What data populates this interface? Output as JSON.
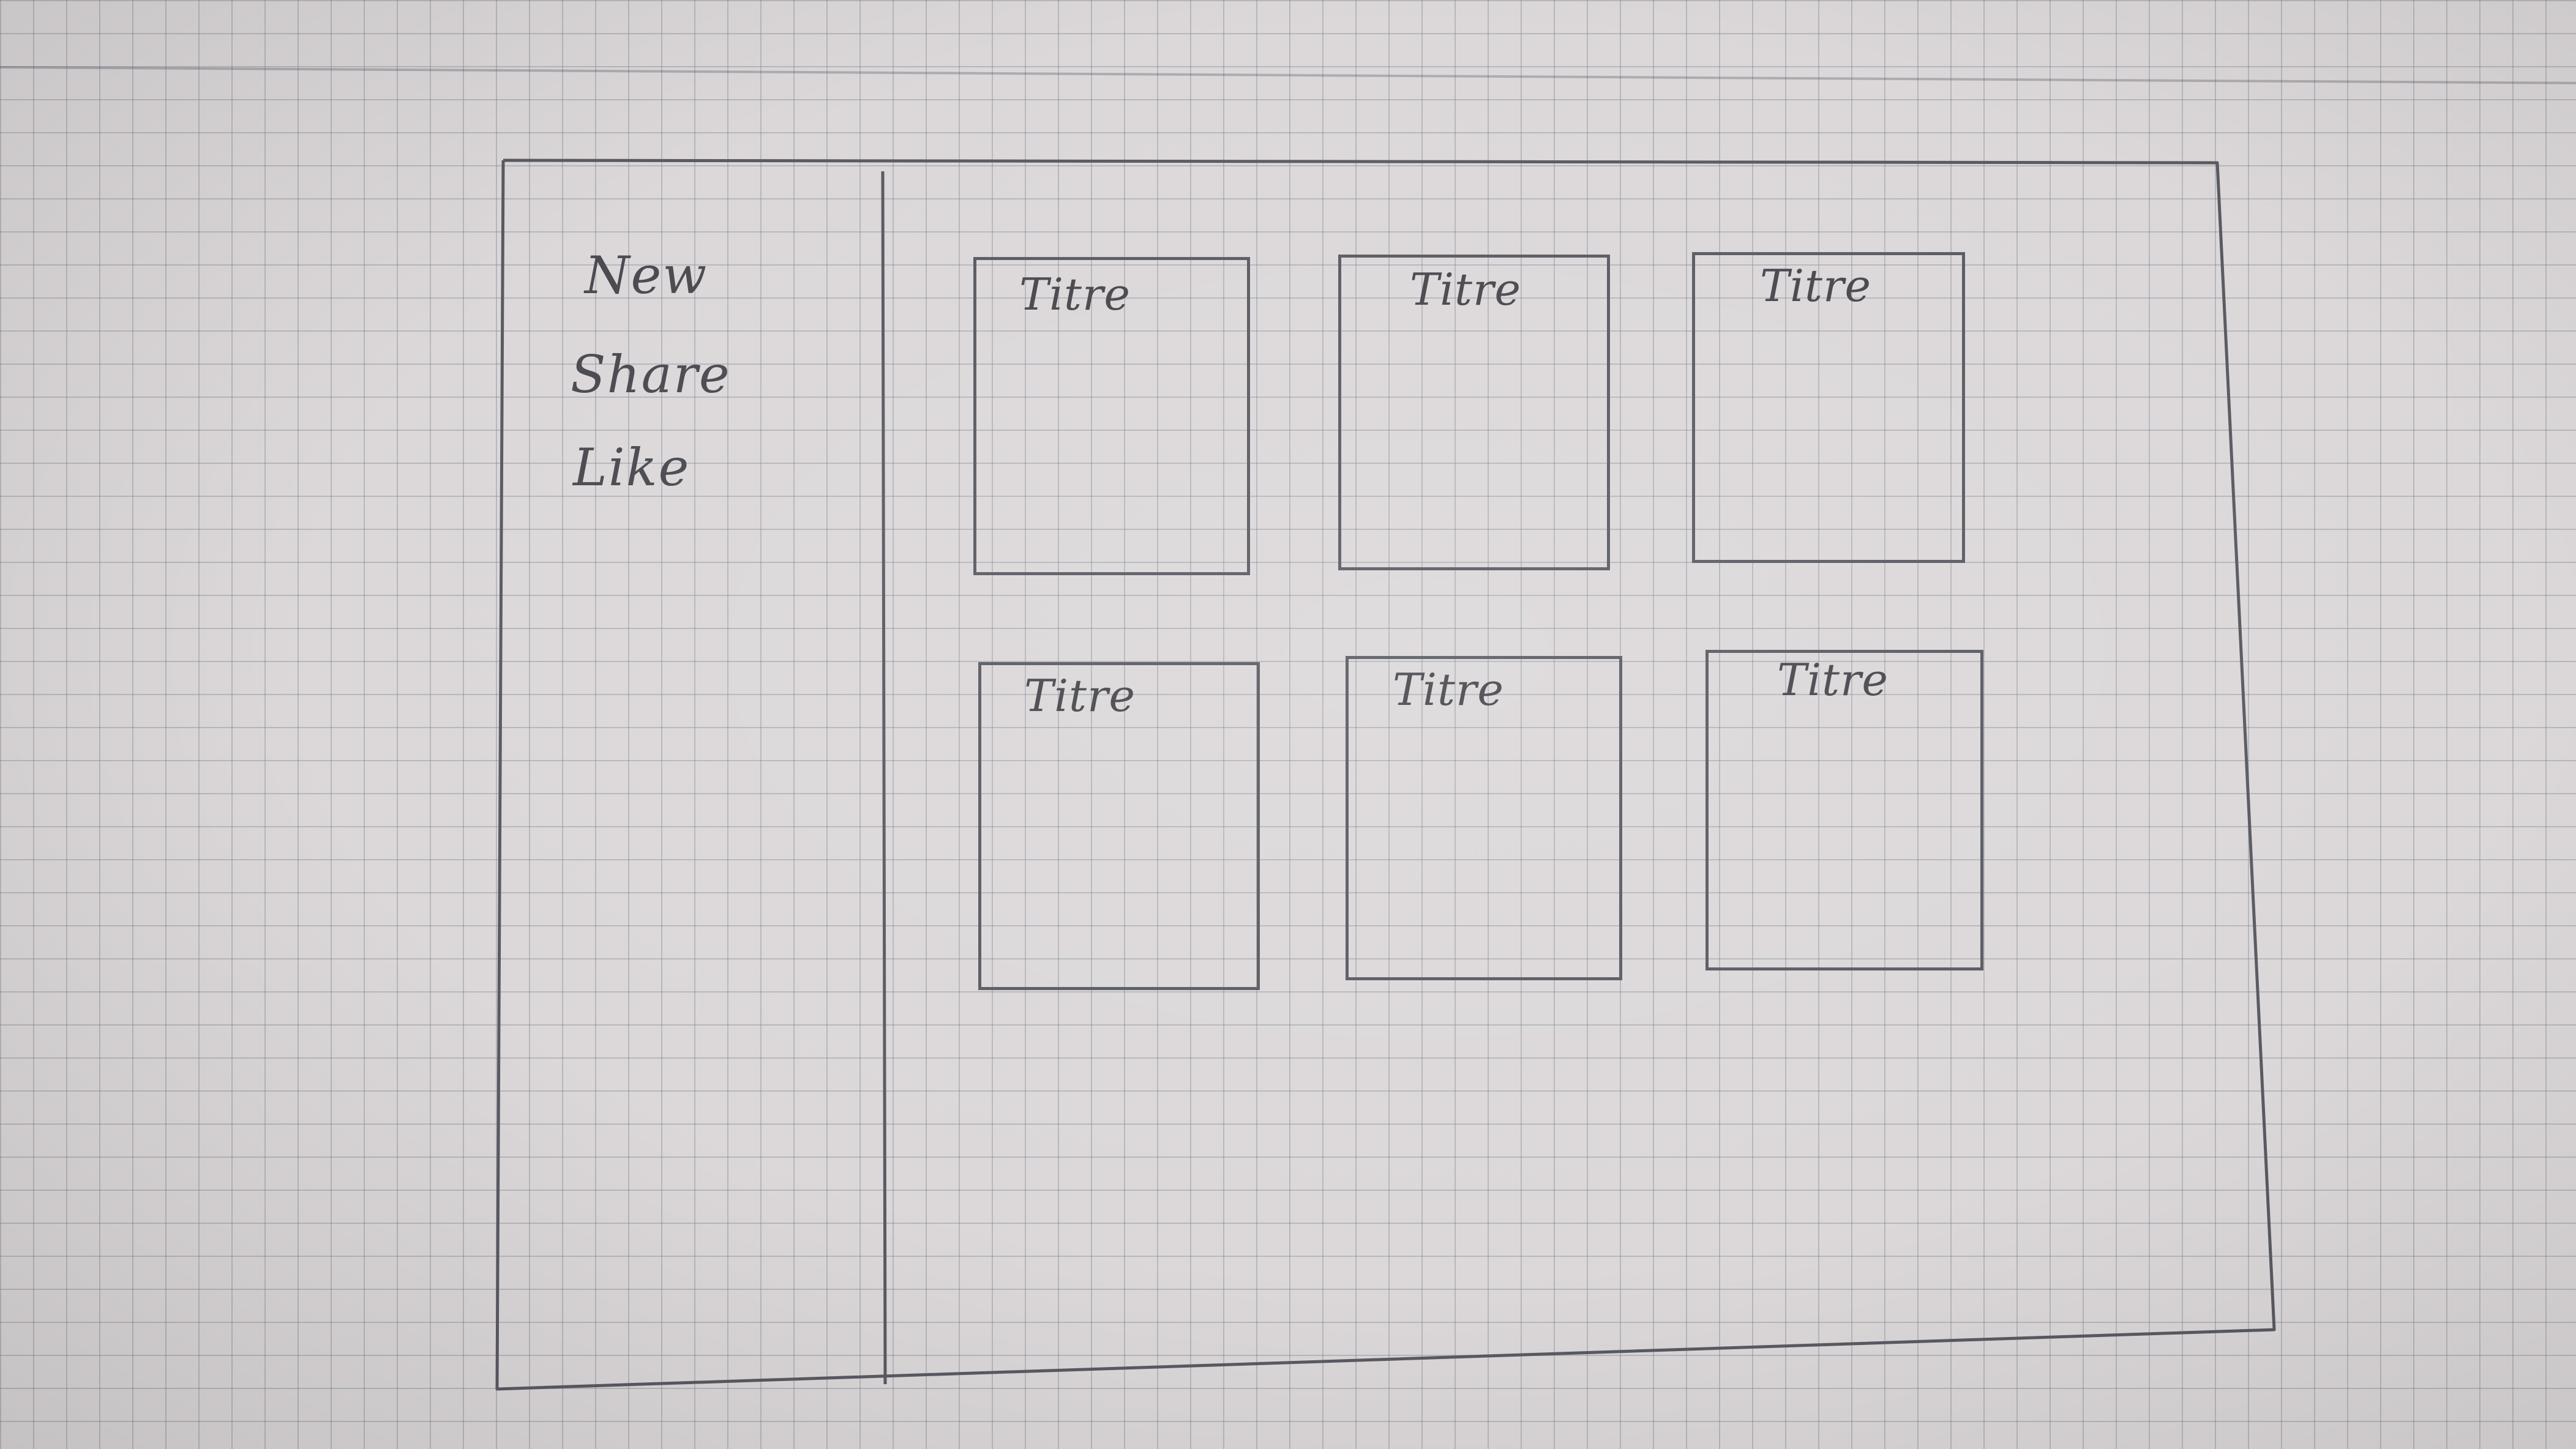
{
  "sidebar": {
    "items": [
      {
        "label": "New"
      },
      {
        "label": "Share"
      },
      {
        "label": "Like"
      }
    ]
  },
  "cards": [
    {
      "title": "Titre"
    },
    {
      "title": "Titre"
    },
    {
      "title": "Titre"
    },
    {
      "title": "Titre"
    },
    {
      "title": "Titre"
    },
    {
      "title": "Titre"
    }
  ],
  "colors": {
    "paper": "#dcd8da",
    "grid": "#7a828c",
    "pencil": "#5a5a62"
  }
}
